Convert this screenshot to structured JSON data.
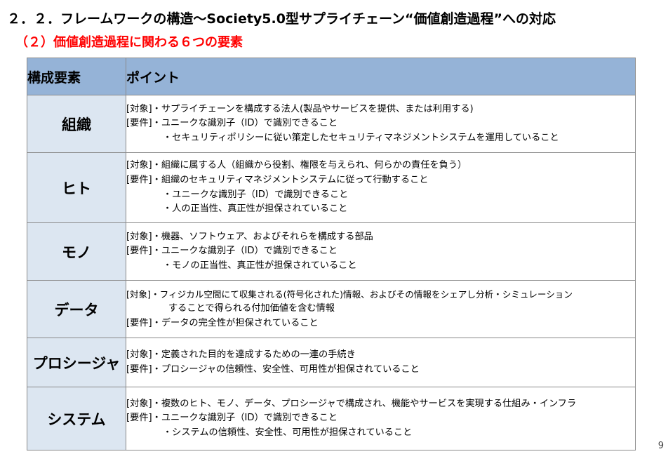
{
  "title": "２．２．フレームワークの構造～Society5.0型サプライチェーン“価値創造過程”への対応",
  "subtitle": "（２）価値創造過程に関わる６つの要素",
  "table": {
    "header": {
      "element": "構成要素",
      "point": "ポイント"
    },
    "rows": [
      {
        "name": "組織",
        "lines": [
          "[対象]・サプライチェーンを構成する法人(製品やサービスを提供、または利用する)",
          "[要件]・ユニークな識別子（ID）で識別できること",
          "・セキュリティポリシーに従い策定したセキュリティマネジメントシステムを運用していること"
        ]
      },
      {
        "name": "ヒト",
        "lines": [
          "[対象]・組織に属する人（組織から役割、権限を与えられ、何らかの責任を負う）",
          "[要件]・組織のセキュリティマネジメントシステムに従って行動すること",
          "・ユニークな識別子（ID）で識別できること",
          "・人の正当性、真正性が担保されていること"
        ]
      },
      {
        "name": "モノ",
        "lines": [
          "[対象]・機器、ソフトウェア、およびそれらを構成する部品",
          "[要件]・ユニークな識別子（ID）で識別できること",
          "・モノの正当性、真正性が担保されていること"
        ]
      },
      {
        "name": "データ",
        "lines": [
          "[対象]・フィジカル空間にて収集される(符号化された)情報、およびその情報をシェアし分析・シミュレーション",
          "することで得られる付加価値を含む情報",
          "[要件]・データの完全性が担保されていること"
        ]
      },
      {
        "name": "プロシージャ",
        "lines": [
          "[対象]・定義された目的を達成するための一連の手続き",
          "[要件]・プロシージャの信頼性、安全性、可用性が担保されていること"
        ]
      },
      {
        "name": "システム",
        "lines": [
          "[対象]・複数のヒト、モノ、データ、プロシージャで構成され、機能やサービスを実現する仕組み・インフラ",
          "[要件]・ユニークな識別子（ID）で識別できること",
          "・システムの信頼性、安全性、可用性が担保されていること"
        ]
      }
    ]
  },
  "page_number": "9"
}
